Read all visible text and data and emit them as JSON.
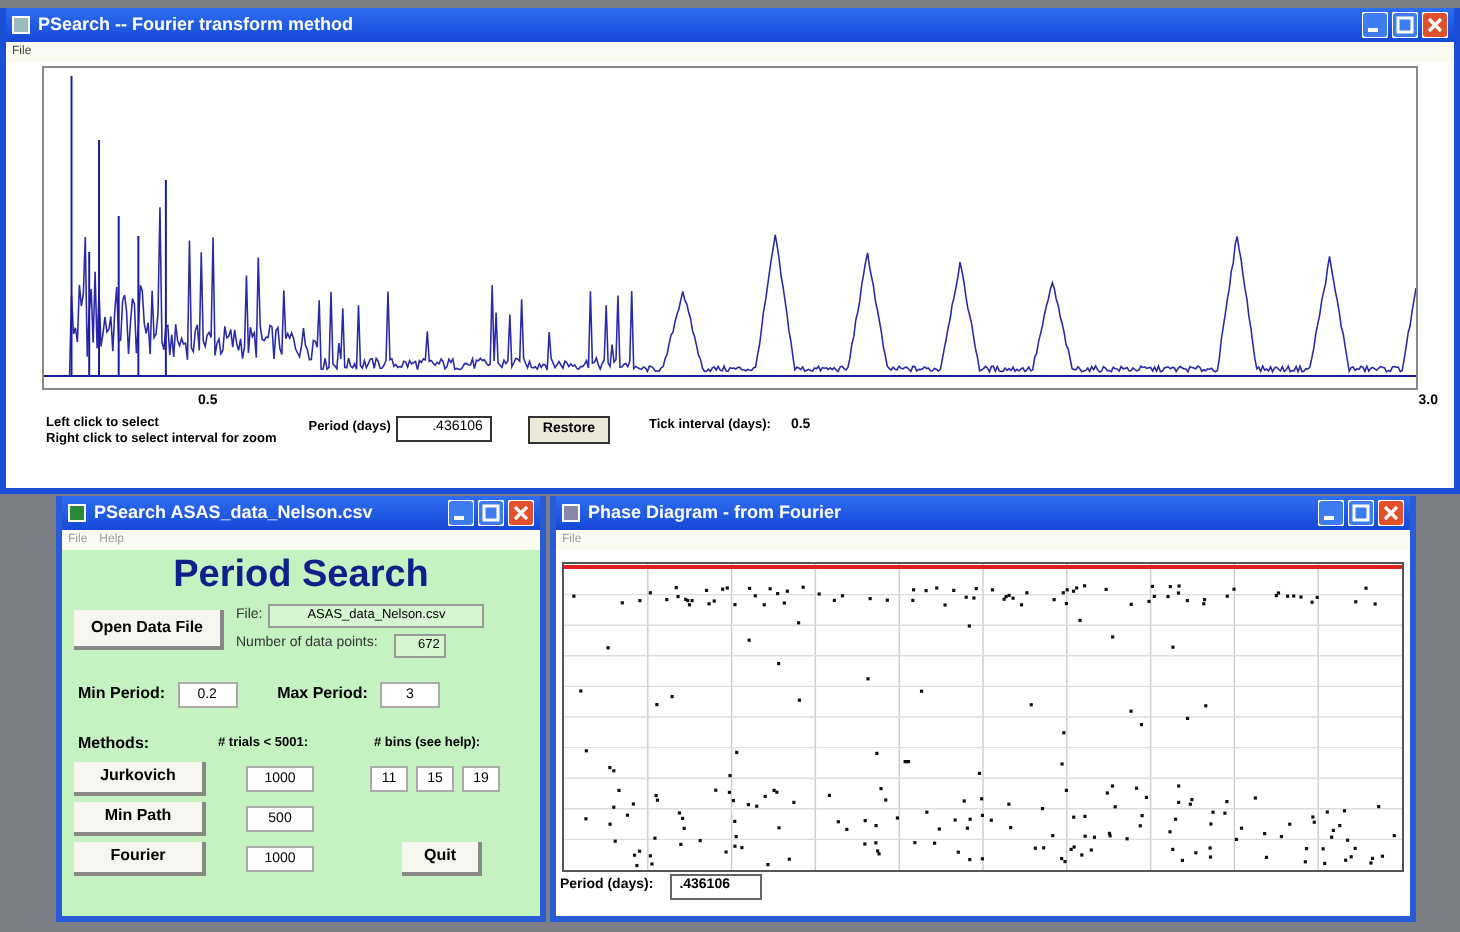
{
  "main_window": {
    "title": "PSearch -- Fourier transform method",
    "menu": [
      "File"
    ],
    "axis_ticks": [
      "0.5",
      "3.0"
    ],
    "hints": [
      "Left click to select",
      "Right click to select interval for zoom"
    ],
    "period_label": "Period (days)",
    "period_value": ".436106",
    "restore_button": "Restore",
    "tick_interval_label": "Tick interval (days):",
    "tick_interval_value": "0.5"
  },
  "search_window": {
    "title": "PSearch  ASAS_data_Nelson.csv",
    "menu": [
      "File",
      "Help"
    ],
    "heading": "Period Search",
    "open_button": "Open Data File",
    "file_label": "File:",
    "file_value": "ASAS_data_Nelson.csv",
    "points_label": "Number of data points:",
    "points_value": "672",
    "min_label": "Min Period:",
    "min_value": "0.2",
    "max_label": "Max Period:",
    "max_value": "3",
    "methods_label": "Methods:",
    "trials_label": "# trials < 5001:",
    "bins_label": "# bins (see help):",
    "methods": [
      {
        "button": "Jurkovich",
        "trials": "1000"
      },
      {
        "button": "Min Path",
        "trials": "500"
      },
      {
        "button": "Fourier",
        "trials": "1000"
      }
    ],
    "bins": [
      "11",
      "15",
      "19"
    ],
    "quit_button": "Quit"
  },
  "phase_window": {
    "title": "Phase Diagram - from Fourier",
    "menu": [
      "File"
    ],
    "period_label": "Period (days):",
    "period_value": ".436106"
  }
}
